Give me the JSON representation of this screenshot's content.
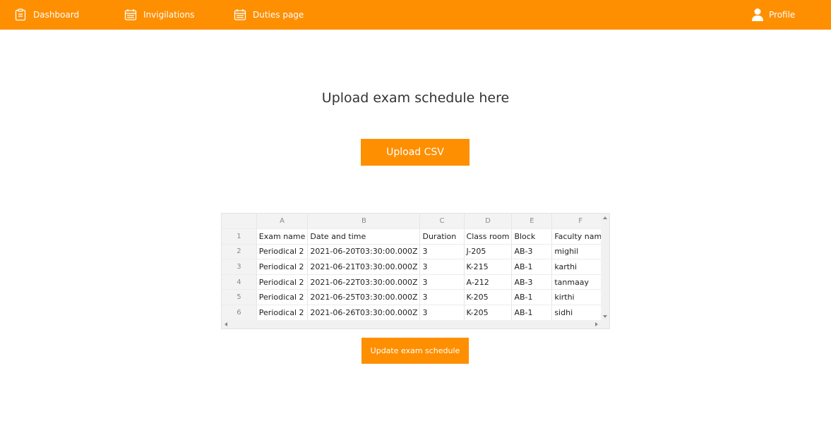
{
  "nav": {
    "dashboard": {
      "label": "Dashboard",
      "icon": "clipboard-icon"
    },
    "invigilations": {
      "label": "Invigilations",
      "icon": "calendar-icon"
    },
    "duties": {
      "label": "Duties page",
      "icon": "calendar-icon"
    },
    "profile": {
      "label": "Profile",
      "icon": "user-icon"
    }
  },
  "main": {
    "title": "Upload exam schedule here",
    "upload_button": "Upload CSV",
    "update_button": "Update exam schedule"
  },
  "sheet": {
    "columns": [
      "A",
      "B",
      "C",
      "D",
      "E",
      "F"
    ],
    "rows": [
      {
        "num": "1",
        "cells": [
          "Exam name",
          "Date and time",
          "Duration",
          "Class room",
          "Block",
          "Faculty name"
        ]
      },
      {
        "num": "2",
        "cells": [
          "Periodical 2",
          "2021-06-20T03:30:00.000Z",
          "3",
          "J-205",
          "AB-3",
          "mighil"
        ]
      },
      {
        "num": "3",
        "cells": [
          "Periodical 2",
          "2021-06-21T03:30:00.000Z",
          "3",
          "K-215",
          "AB-1",
          "karthi"
        ]
      },
      {
        "num": "4",
        "cells": [
          "Periodical 2",
          "2021-06-22T03:30:00.000Z",
          "3",
          "A-212",
          "AB-3",
          "tanmaay"
        ]
      },
      {
        "num": "5",
        "cells": [
          "Periodical 2",
          "2021-06-25T03:30:00.000Z",
          "3",
          "K-205",
          "AB-1",
          "kirthi"
        ]
      },
      {
        "num": "6",
        "cells": [
          "Periodical 2",
          "2021-06-26T03:30:00.000Z",
          "3",
          "K-205",
          "AB-1",
          "sidhi"
        ]
      }
    ]
  },
  "colors": {
    "accent": "#fe8f00",
    "header_bg": "#f3f3f3"
  }
}
